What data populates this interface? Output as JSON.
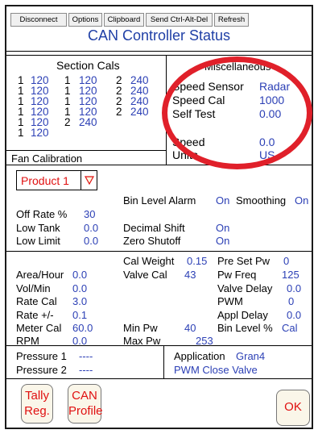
{
  "toolbar": {
    "disconnect": "Disconnect",
    "options": "Options",
    "clipboard": "Clipboard",
    "send_cad": "Send Ctrl-Alt-Del",
    "refresh": "Refresh"
  },
  "page_title": "CAN Controller Status",
  "section_cals": {
    "header": "Section Cals",
    "col1": [
      {
        "num": "1",
        "val": "120"
      },
      {
        "num": "1",
        "val": "120"
      },
      {
        "num": "1",
        "val": "120"
      },
      {
        "num": "1",
        "val": "120"
      },
      {
        "num": "1",
        "val": "120"
      },
      {
        "num": "1",
        "val": "120"
      }
    ],
    "col2": [
      {
        "num": "1",
        "val": "120"
      },
      {
        "num": "1",
        "val": "120"
      },
      {
        "num": "1",
        "val": "120"
      },
      {
        "num": "1",
        "val": "120"
      },
      {
        "num": "2",
        "val": "240"
      }
    ],
    "col3": [
      {
        "num": "2",
        "val": "240"
      },
      {
        "num": "2",
        "val": "240"
      },
      {
        "num": "2",
        "val": "240"
      },
      {
        "num": "2",
        "val": "240"
      }
    ]
  },
  "misc": {
    "header": "Miscellaneous",
    "speed_sensor_label": "Speed Sensor",
    "speed_sensor_value": "Radar",
    "speed_cal_label": "Speed Cal",
    "speed_cal_value": "1000",
    "self_test_label": "Self Test",
    "self_test_value": "0.00",
    "speed_label": "Speed",
    "speed_value": "0.0",
    "units_label": "Units",
    "units_value": "US"
  },
  "fan_calibration": "Fan Calibration",
  "product_select": "Product 1",
  "alarms": {
    "bin_level_alarm_label": "Bin Level Alarm",
    "bin_level_alarm_value": "On",
    "smoothing_label": "Smoothing",
    "smoothing_value": "On",
    "off_rate_label": "Off Rate %",
    "off_rate_value": "30",
    "low_tank_label": "Low Tank",
    "low_tank_value": "0.0",
    "decimal_shift_label": "Decimal Shift",
    "decimal_shift_value": "On",
    "low_limit_label": "Low Limit",
    "low_limit_value": "0.0",
    "zero_shutoff_label": "Zero Shutoff",
    "zero_shutoff_value": "On"
  },
  "product": {
    "cal_weight_label": "Cal Weight",
    "cal_weight_value": "0.15",
    "pre_set_pw_label": "Pre Set Pw",
    "pre_set_pw_value": "0",
    "area_hour_label": "Area/Hour",
    "area_hour_value": "0.0",
    "valve_cal_label": "Valve Cal",
    "valve_cal_value": "43",
    "pw_freq_label": "Pw Freq",
    "pw_freq_value": "125",
    "vol_min_label": "Vol/Min",
    "vol_min_value": "0.0",
    "valve_delay_label": "Valve Delay",
    "valve_delay_value": "0.0",
    "rate_cal_label": "Rate Cal",
    "rate_cal_value": "3.0",
    "pwm_label": "PWM",
    "pwm_value": "0",
    "rate_pm_label": "Rate +/-",
    "rate_pm_value": "0.1",
    "appl_delay_label": "Appl Delay",
    "appl_delay_value": "0.0",
    "meter_cal_label": "Meter Cal",
    "meter_cal_value": "60.0",
    "min_pw_label": "Min Pw",
    "min_pw_value": "40",
    "bin_level_pct_label": "Bin Level %",
    "bin_level_pct_value": "Cal",
    "rpm_label": "RPM",
    "rpm_value": "0.0",
    "max_pw_label": "Max Pw",
    "max_pw_value": "253"
  },
  "pressure": {
    "p1_label": "Pressure 1",
    "p1_value": "----",
    "p2_label": "Pressure 2",
    "p2_value": "----",
    "application_label": "Application",
    "application_value": "Gran4",
    "pwm_close_valve": "PWM Close Valve"
  },
  "buttons": {
    "tally_line1": "Tally",
    "tally_line2": "Reg.",
    "can_line1": "CAN",
    "can_line2": "Profile",
    "ok": "OK"
  }
}
